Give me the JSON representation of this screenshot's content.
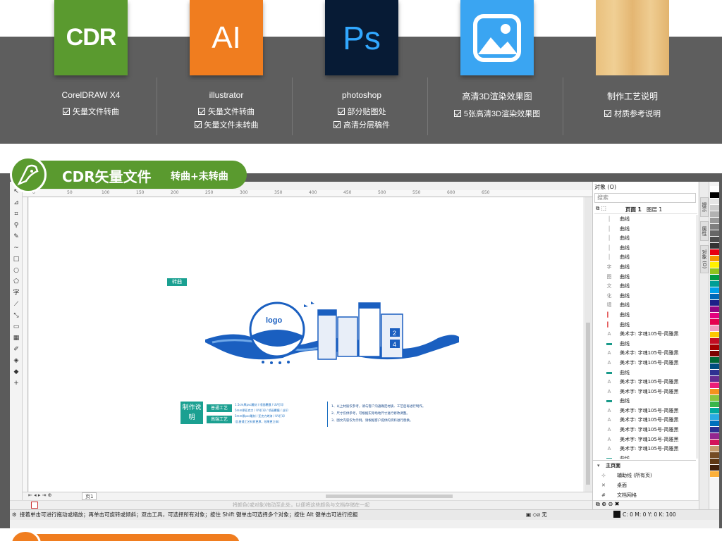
{
  "software": [
    {
      "tile": "CDR",
      "name": "CorelDRAW X4",
      "features": [
        "矢量文件转曲"
      ]
    },
    {
      "tile": "AI",
      "name": "illustrator",
      "features": [
        "矢量文件转曲",
        "矢量文件未转曲"
      ]
    },
    {
      "tile": "Ps",
      "name": "photoshop",
      "features": [
        "部分贴图处",
        "高清分层稿件"
      ]
    },
    {
      "tile": "",
      "icon": "image-icon",
      "name": "高清3D渲染效果图",
      "features": [
        "5张高清3D渲染效果图"
      ]
    },
    {
      "tile": "",
      "icon": "wood-texture",
      "name": "制作工艺说明",
      "features": [
        "材质参考说明"
      ]
    }
  ],
  "section": {
    "title": "CDR矢量文件",
    "subtitle": "转曲+未转曲"
  },
  "ruler_ticks": [
    "0",
    "50",
    "100",
    "150",
    "200",
    "250",
    "300",
    "350",
    "400",
    "450",
    "500",
    "550",
    "600",
    "650"
  ],
  "canvas": {
    "tag": "转曲",
    "craft": {
      "label": "制作说明",
      "chip1": "普通工艺",
      "chip2": "高端工艺",
      "line1": "1.5cm厚pvc雕刻 / 喷画覆膜 / UV打印",
      "line2": "5mm厚亚克力 / UV打印 / 喷画覆膜 / 丝印",
      "line3": "5mm厚pvc雕刻 / 亚克力烤漆 / UV打印",
      "line4": "(比普通工艺材质更厚，效果更立体)",
      "r1": "1、以上材质仅参考，请与客户沟通确定材质、工艺后再进行制作。",
      "r2": "2、尺寸仅供参考，可根据实际场地尺寸进行修改调整。",
      "r3": "3、图文内容仅为示例，请根据客户提供的资料进行替换。"
    }
  },
  "page_tab": "页1",
  "drop_hint": "将颜色(或对象)拖动至此处，以便将这些颜色与文档存储在一起",
  "status": {
    "message": "接着单击可进行拖动或缩放；再单击可旋转或倾斜；双击工具，可选择所有对象；按住 Shift 键单击可选择多个对象；按住 Alt 键单击可进行挖掘",
    "fill": "无",
    "cmyk": "C: 0 M: 0 Y: 0 K: 100"
  },
  "docker": {
    "title": "对象 (O)",
    "search_placeholder": "搜索",
    "page": "页面 1",
    "layer": "图层 1",
    "items": [
      {
        "icon": "line",
        "label": "曲线"
      },
      {
        "icon": "line",
        "label": "曲线"
      },
      {
        "icon": "line",
        "label": "曲线"
      },
      {
        "icon": "line",
        "label": "曲线"
      },
      {
        "icon": "line",
        "label": "曲线"
      },
      {
        "icon": "glyph",
        "label": "曲线"
      },
      {
        "icon": "glyph",
        "label": "曲线"
      },
      {
        "icon": "glyph",
        "label": "曲线"
      },
      {
        "icon": "glyph",
        "label": "曲线"
      },
      {
        "icon": "glyph",
        "label": "曲线"
      },
      {
        "icon": "red",
        "label": "曲线"
      },
      {
        "icon": "red",
        "label": "曲线"
      },
      {
        "icon": "text",
        "label": "美术字: 字魂105号-简雅黑"
      },
      {
        "icon": "teal",
        "label": "曲线"
      },
      {
        "icon": "text",
        "label": "美术字: 字魂105号-简雅黑"
      },
      {
        "icon": "text",
        "label": "美术字: 字魂105号-简雅黑"
      },
      {
        "icon": "teal",
        "label": "曲线"
      },
      {
        "icon": "text",
        "label": "美术字: 字魂105号-简雅黑"
      },
      {
        "icon": "text",
        "label": "美术字: 字魂105号-简雅黑"
      },
      {
        "icon": "teal",
        "label": "曲线"
      },
      {
        "icon": "text",
        "label": "美术字: 字魂105号-简雅黑"
      },
      {
        "icon": "text",
        "label": "美术字: 字魂105号-简雅黑"
      },
      {
        "icon": "text",
        "label": "美术字: 字魂105号-简雅黑"
      },
      {
        "icon": "text",
        "label": "美术字: 字魂105号-简雅黑"
      },
      {
        "icon": "text",
        "label": "美术字: 字魂105号-简雅黑"
      },
      {
        "icon": "teal",
        "label": "曲线"
      },
      {
        "icon": "teal",
        "label": "曲线"
      }
    ],
    "master_title": "主页面",
    "master_items": [
      "辅助线 (所有页)",
      "桌面",
      "文档网格"
    ]
  },
  "side_tabs": [
    "提示",
    "属性",
    "对象 (O)"
  ],
  "palette": [
    "#ffffff",
    "#000000",
    "#e5e5e5",
    "#cccccc",
    "#b2b2b2",
    "#999999",
    "#7f7f7f",
    "#666666",
    "#4c4c4c",
    "#333333",
    "#e60012",
    "#f39800",
    "#fff100",
    "#8fc31f",
    "#009944",
    "#009e96",
    "#00a0e9",
    "#0068b7",
    "#1d2088",
    "#920783",
    "#e4007f",
    "#e5004f",
    "#f19ec2",
    "#fcc800",
    "#c30d23",
    "#a40000",
    "#7d0000",
    "#006837",
    "#004d80",
    "#2e3192",
    "#662d91",
    "#ed1e79",
    "#f7931e",
    "#8cc63f",
    "#39b54a",
    "#00a99d",
    "#29abe2",
    "#0071bc",
    "#2e3192",
    "#93278f",
    "#d4145a",
    "#c69c6d",
    "#754c24",
    "#603813",
    "#42210b",
    "#fbb03b"
  ],
  "colors": {
    "cdr_green": "#5a9a2f",
    "ai_orange": "#f07d1f",
    "ps_navy": "#071b35",
    "ps_blue": "#31a8ff",
    "img_blue": "#3aa5f2",
    "banner_gray": "#5e5e5e",
    "teal": "#1aa091",
    "design_blue": "#1a5fc0"
  }
}
